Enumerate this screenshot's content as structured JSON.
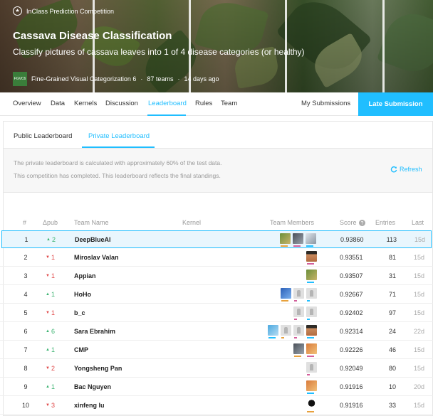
{
  "banner": {
    "type_label": "InClass Prediction Competition",
    "title": "Cassava Disease Classification",
    "subtitle": "Classify pictures of cassava leaves into 1 of 4 disease categories (or healthy)",
    "host_logo": "FGVC6",
    "host_name": "Fine-Grained Visual Categorization 6",
    "teams": "87 teams",
    "ago": "14 days ago",
    "separator": "·"
  },
  "nav": {
    "items": [
      "Overview",
      "Data",
      "Kernels",
      "Discussion",
      "Leaderboard",
      "Rules",
      "Team"
    ],
    "active": "Leaderboard",
    "my_submissions": "My Submissions",
    "late_submission": "Late Submission"
  },
  "leaderboard": {
    "tabs": [
      "Public Leaderboard",
      "Private Leaderboard"
    ],
    "active_tab": "Private Leaderboard",
    "info_1": "The private leaderboard is calculated with approximately 60% of the test data.",
    "info_2": "This competition has completed. This leaderboard reflects the final standings.",
    "refresh": "Refresh",
    "headers": {
      "rank": "#",
      "change": "Δpub",
      "team": "Team Name",
      "kernel": "Kernel",
      "members": "Team Members",
      "score": "Score",
      "entries": "Entries",
      "last": "Last"
    },
    "rows": [
      {
        "rank": "1",
        "dir": "up",
        "delta": "2",
        "team": "DeepBlueAI",
        "score": "0.93860",
        "entries": "113",
        "last": "15d",
        "highlight": true,
        "members": [
          "photo-green",
          "photo-gray",
          "photo-light"
        ]
      },
      {
        "rank": "2",
        "dir": "down",
        "delta": "1",
        "team": "Miroslav Valan",
        "score": "0.93551",
        "entries": "81",
        "last": "15d",
        "members": [
          "photo-face"
        ]
      },
      {
        "rank": "3",
        "dir": "down",
        "delta": "1",
        "team": "Appian",
        "score": "0.93507",
        "entries": "31",
        "last": "15d",
        "members": [
          "photo-green"
        ]
      },
      {
        "rank": "4",
        "dir": "up",
        "delta": "1",
        "team": "HoHo",
        "score": "0.92667",
        "entries": "71",
        "last": "15d",
        "members": [
          "photo-blue",
          "generic",
          "generic"
        ]
      },
      {
        "rank": "5",
        "dir": "down",
        "delta": "1",
        "team": "b_c",
        "score": "0.92402",
        "entries": "97",
        "last": "15d",
        "members": [
          "generic",
          "generic"
        ]
      },
      {
        "rank": "6",
        "dir": "up",
        "delta": "6",
        "team": "Sara Ebrahim",
        "score": "0.92314",
        "entries": "24",
        "last": "22d",
        "members": [
          "photo-sky",
          "generic",
          "generic",
          "photo-face"
        ]
      },
      {
        "rank": "7",
        "dir": "up",
        "delta": "1",
        "team": "CMP",
        "score": "0.92226",
        "entries": "46",
        "last": "15d",
        "members": [
          "photo-gray",
          "photo-orange"
        ]
      },
      {
        "rank": "8",
        "dir": "down",
        "delta": "2",
        "team": "Yongsheng Pan",
        "score": "0.92049",
        "entries": "80",
        "last": "15d",
        "members": [
          "generic"
        ]
      },
      {
        "rank": "9",
        "dir": "up",
        "delta": "1",
        "team": "Bac Nguyen",
        "score": "0.91916",
        "entries": "10",
        "last": "20d",
        "members": [
          "photo-orange"
        ]
      },
      {
        "rank": "10",
        "dir": "down",
        "delta": "3",
        "team": "xinfeng lu",
        "score": "0.91916",
        "entries": "33",
        "last": "15d",
        "members": [
          "photo-dark"
        ]
      }
    ]
  },
  "colors": {
    "accent": "#20beff",
    "up": "#3cb371",
    "down": "#e04747"
  },
  "icons": {
    "competition_type": "trophy-icon",
    "refresh": "refresh-icon",
    "score_help": "help-icon",
    "up": "triangle-up-icon",
    "down": "triangle-down-icon"
  }
}
